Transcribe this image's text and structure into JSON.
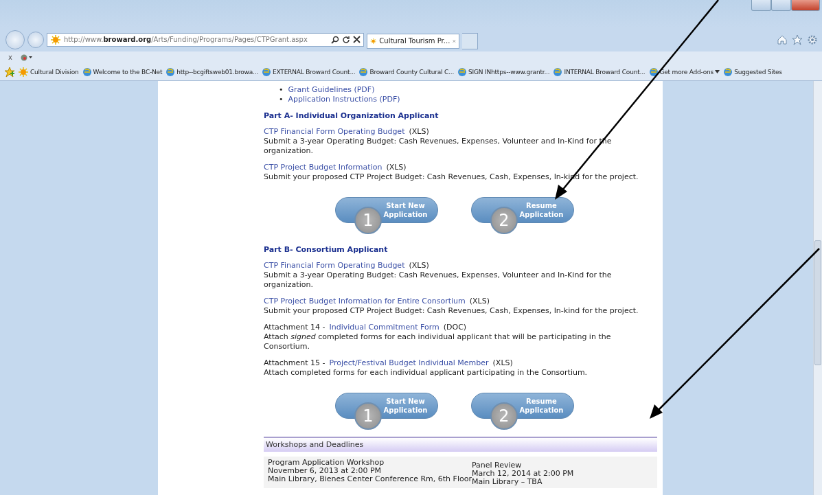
{
  "browser": {
    "address": "http://www.**broward.org**/Arts/Funding/Programs/Pages/CTPGrant.aspx",
    "tab": {
      "title": "Cultural Tourism Pr...",
      "selected": true
    },
    "command_bar": {
      "close": "x"
    },
    "favorites": [
      {
        "kind": "site",
        "label": "Cultural Division"
      },
      {
        "kind": "page",
        "label": "Welcome to the BC-Net"
      },
      {
        "kind": "page",
        "label": "http--bcgiftsweb01.browa..."
      },
      {
        "kind": "page",
        "label": "EXTERNAL Broward Count..."
      },
      {
        "kind": "page",
        "label": "Broward County Cultural C..."
      },
      {
        "kind": "page",
        "label": "SIGN INhttps--www.grantr..."
      },
      {
        "kind": "page",
        "label": "INTERNAL Broward Count..."
      },
      {
        "kind": "dropdown",
        "label": "Get more Add-ons"
      },
      {
        "kind": "page",
        "label": "Suggested Sites"
      }
    ]
  },
  "page": {
    "documents": [
      {
        "bullet": "•",
        "label": "Grant Guidelines (PDF)"
      },
      {
        "bullet": "•",
        "label": "Application Instructions (PDF)"
      }
    ],
    "sections": [
      {
        "heading": "Part A- Individual Organization Applicant",
        "items": [
          {
            "link": "CTP Financial Form Operating Budget",
            "format": "(XLS)",
            "description": "Submit a 3-year Operating Budget:  Cash Revenues, Expenses, Volunteer and In-Kind for the organization."
          },
          {
            "link": "CTP Project Budget Information",
            "format": "(XLS)",
            "description": "Submit your proposed CTP Project Budget:  Cash Revenues, Cash, Expenses, In-kind for the project."
          }
        ],
        "buttons": [
          {
            "number": "1",
            "line1": "Start New",
            "line2": "Application"
          },
          {
            "number": "2",
            "line1": "Resume",
            "line2": "Application"
          }
        ]
      },
      {
        "heading": "Part B- Consortium Applicant",
        "items": [
          {
            "link": "CTP Financial Form Operating Budget",
            "format": "(XLS)",
            "description": "Submit a 3-year Operating Budget:  Cash Revenues, Expenses, Volunteer and In-Kind for the organization."
          },
          {
            "link": "CTP Project Budget Information for Entire Consortium",
            "format": "(XLS)",
            "description": "Submit your proposed CTP Project Budget:  Cash Revenues, Cash, Expenses, In-kind for the project."
          },
          {
            "prefix": "Attachment 14 -",
            "link": "Individual Commitment Form",
            "format": "(DOC)",
            "description": "Attach *signed* completed forms for each individual applicant that will be participating in the Consortium."
          },
          {
            "prefix": "Attachment 15 -",
            "link": "Project/Festival Budget Individual Member",
            "format": "(XLS)",
            "description": "Attach completed forms for each individual applicant participating in the Consortium."
          }
        ],
        "buttons": [
          {
            "number": "1",
            "line1": "Start New",
            "line2": "Application"
          },
          {
            "number": "2",
            "line1": "Resume",
            "line2": "Application"
          }
        ]
      }
    ],
    "workshops": {
      "title": "Workshops and Deadlines",
      "columns": [
        [
          "Program Application Workshop",
          "November 6, 2013 at 2:00 PM",
          "Main Library, Bienes Center Conference Rm, 6th Floor"
        ],
        [
          "Panel Review",
          "March 12, 2014 at 2:00 PM",
          "Main Library – TBA"
        ]
      ]
    }
  }
}
